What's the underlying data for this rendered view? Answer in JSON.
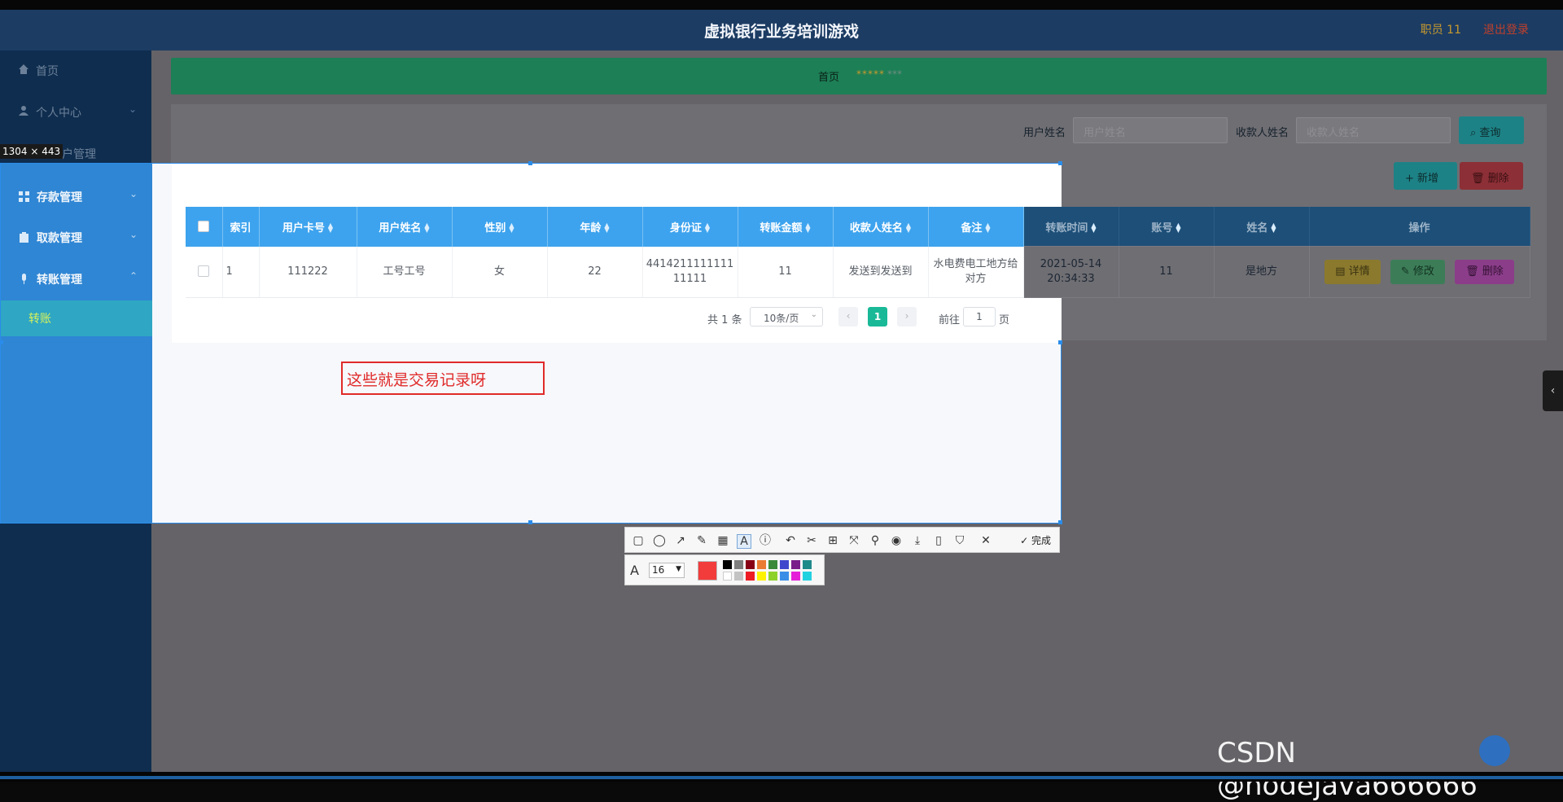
{
  "header": {
    "title": "虚拟银行业务培训游戏",
    "user": "职员 11",
    "logout": "退出登录"
  },
  "sidebar": {
    "items": [
      {
        "label": "首页",
        "icon": "home-icon"
      },
      {
        "label": "个人中心",
        "icon": "user-icon"
      },
      {
        "label": "销户管理",
        "icon": "account-icon"
      },
      {
        "label": "存款管理",
        "icon": "grid-icon"
      },
      {
        "label": "取款管理",
        "icon": "clipboard-icon"
      },
      {
        "label": "转账管理",
        "icon": "mic-icon"
      }
    ],
    "active_sub": "转账"
  },
  "breadcrumb": {
    "home": "首页",
    "mid": "*****",
    "current": "***"
  },
  "filters": {
    "user_label": "用户姓名",
    "user_placeholder": "用户姓名",
    "payee_label": "收款人姓名",
    "payee_placeholder": "收款人姓名",
    "search": "查询",
    "add": "+ 新增",
    "delete": "删除"
  },
  "table": {
    "headers": [
      "索引",
      "用户卡号",
      "用户姓名",
      "性别",
      "年龄",
      "身份证",
      "转账金额",
      "收款人姓名",
      "备注",
      "转账时间",
      "账号",
      "姓名",
      "操作"
    ],
    "rows": [
      {
        "index": "1",
        "card": "111222",
        "name": "工号工号",
        "gender": "女",
        "age": "22",
        "id_card": "441421111111111111",
        "amount": "11",
        "payee": "发送到发送到",
        "remark": "水电费电工地方给对方",
        "time": "2021-05-14 20:34:33",
        "account": "11",
        "holder": "是地方"
      }
    ],
    "actions": {
      "detail": "详情",
      "edit": "修改",
      "delete": "删除"
    }
  },
  "pagination": {
    "total": "共 1 条",
    "page_size": "10条/页",
    "current": "1",
    "goto_prefix": "前往",
    "goto_value": "1",
    "goto_suffix": "页"
  },
  "capture": {
    "size": "1304 × 443",
    "annotation": "这些就是交易记录呀"
  },
  "toolbar": {
    "done": "完成",
    "font_size": "16"
  },
  "watermark": "CSDN @nodejava666666",
  "colors": {
    "header": "#1c3c63",
    "table_header": "#3da3ee",
    "annotation": "#e02a2a",
    "accent_green": "#1d7f56"
  }
}
